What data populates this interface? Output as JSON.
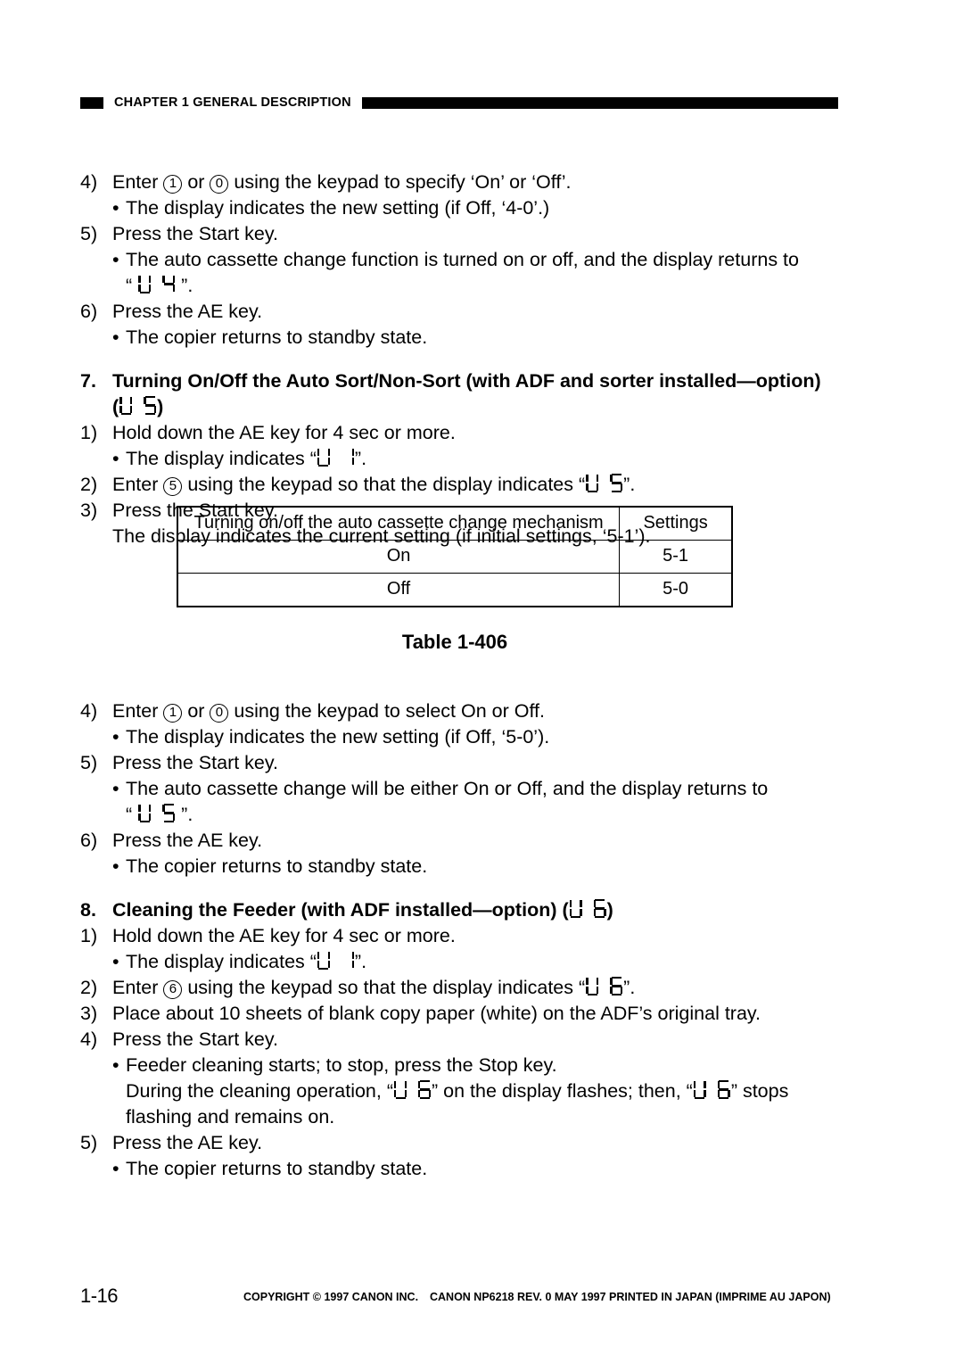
{
  "header": {
    "chapter_label": "CHAPTER 1  GENERAL DESCRIPTION"
  },
  "section_6_tail": {
    "step4": {
      "num": "4)",
      "text_a": "Enter ",
      "circle_1": "1",
      "text_b": " or ",
      "circle_0": "0",
      "text_c": " using the keypad to specify ‘On’ or ‘Off’."
    },
    "step4_bullet": {
      "dot": "•",
      "text": "The display indicates the new setting (if Off, ‘4-0’.)"
    },
    "step5": {
      "num": "5)",
      "text": "Press the Start key."
    },
    "step5_bullet": {
      "dot": "•",
      "text": "The auto cassette change function is turned on or off, and the display returns to"
    },
    "step5_disp": {
      "open_quote": "“",
      "code": "U 4",
      "close_quote": "”",
      "period": "."
    },
    "step6": {
      "num": "6)",
      "text": "Press the AE key."
    },
    "step6_bullet": {
      "dot": "•",
      "text": "The copier returns to standby state."
    }
  },
  "section_7": {
    "num": "7.",
    "title": "Turning On/Off the Auto Sort/Non-Sort (with ADF and sorter installed—option)",
    "code_open": "(",
    "code": "U 5",
    "code_close": ")",
    "steps": {
      "s1": {
        "num": "1)",
        "text": "Hold down the AE key for 4 sec or more."
      },
      "s1_bullet_a": {
        "dot": "•",
        "text": "The display indicates “"
      },
      "s1_bullet_code": "U 1",
      "s1_bullet_b": "”.",
      "s2_a": {
        "num": "2)",
        "text_a": "Enter ",
        "circle_5": "5",
        "text_b": " using the keypad so that the display indicates “"
      },
      "s2_code": "U 5",
      "s2_b": "”.",
      "s3": {
        "num": "3)",
        "text": "Press the Start key."
      },
      "s3_cont": "The display indicates the current setting (if initial settings, ‘5-1’)."
    }
  },
  "table": {
    "caption": "Table 1-406",
    "columns": [
      "Turning on/off the auto cassette change mechanism",
      "Settings"
    ],
    "rows": [
      [
        "On",
        "5-1"
      ],
      [
        "Off",
        "5-0"
      ]
    ]
  },
  "section_7_tail": {
    "step4": {
      "num": "4)",
      "text_a": "Enter ",
      "circle_1": "1",
      "text_b": " or ",
      "circle_0": "0",
      "text_c": " using the keypad to select On or Off."
    },
    "step4_bullet": {
      "dot": "•",
      "text": "The display indicates the new setting (if Off, ‘5-0’)."
    },
    "step5": {
      "num": "5)",
      "text": "Press the Start key."
    },
    "step5_bullet": {
      "dot": "•",
      "text": "The auto cassette change will be either On or Off, and the display returns to"
    },
    "step5_disp": {
      "open_quote": "“",
      "code": "U 5",
      "close_quote": "”",
      "period": "."
    },
    "step6": {
      "num": "6)",
      "text": "Press the AE key."
    },
    "step6_bullet": {
      "dot": "•",
      "text": "The copier returns to standby state."
    }
  },
  "section_8": {
    "num": "8.",
    "title": "Cleaning the Feeder (with ADF installed—option) (",
    "code": "U 6",
    "title_close": ")",
    "steps": {
      "s1": {
        "num": "1)",
        "text": "Hold down the AE key for 4 sec or more."
      },
      "s1_bullet_a": {
        "dot": "•",
        "text": "The display indicates “"
      },
      "s1_bullet_code": "U 1",
      "s1_bullet_b": "”.",
      "s2_a": {
        "num": "2)",
        "text_a": "Enter ",
        "circle_6": "6",
        "text_b": " using the keypad so that the display indicates “"
      },
      "s2_code": "U 6",
      "s2_b": "”.",
      "s3": {
        "num": "3)",
        "text": "Place about 10 sheets of blank copy paper (white) on the ADF’s original tray."
      },
      "s4": {
        "num": "4)",
        "text": "Press the Start key."
      },
      "s4_bullet": {
        "dot": "•",
        "text": "Feeder cleaning starts; to stop, press the Stop key."
      },
      "s4_cont_a": "During the cleaning operation, “",
      "s4_cont_code1": "U 6",
      "s4_cont_b": "” on the display flashes; then, “",
      "s4_cont_code2": "U 6",
      "s4_cont_c": "” stops",
      "s4_cont2": "flashing and remains on.",
      "s5": {
        "num": "5)",
        "text": "Press the AE key."
      },
      "s5_bullet": {
        "dot": "•",
        "text": "The copier returns to standby state."
      }
    }
  },
  "footer": {
    "page_number": "1-16",
    "copyright": "COPYRIGHT © 1997 CANON INC.",
    "revision": "CANON NP6218 REV. 0 MAY 1997 PRINTED IN JAPAN (IMPRIME AU JAPON)"
  }
}
